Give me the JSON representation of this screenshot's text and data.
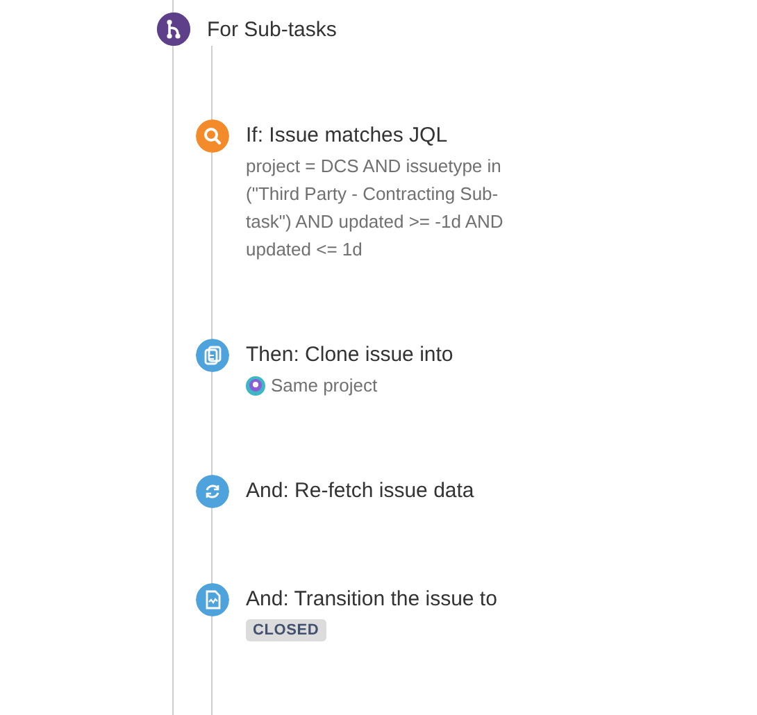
{
  "branch": {
    "title": "For Sub-tasks"
  },
  "steps": [
    {
      "kind": "condition",
      "title": "If: Issue matches JQL",
      "detail": "project = DCS AND issuetype in (\"Third Party - Contracting Sub-task\") AND updated >= -1d AND updated <= 1d"
    },
    {
      "kind": "clone",
      "title": "Then: Clone issue into",
      "project": "Same project"
    },
    {
      "kind": "refetch",
      "title": "And: Re-fetch issue data"
    },
    {
      "kind": "transition",
      "title": "And: Transition the issue to",
      "status": "CLOSED"
    }
  ]
}
